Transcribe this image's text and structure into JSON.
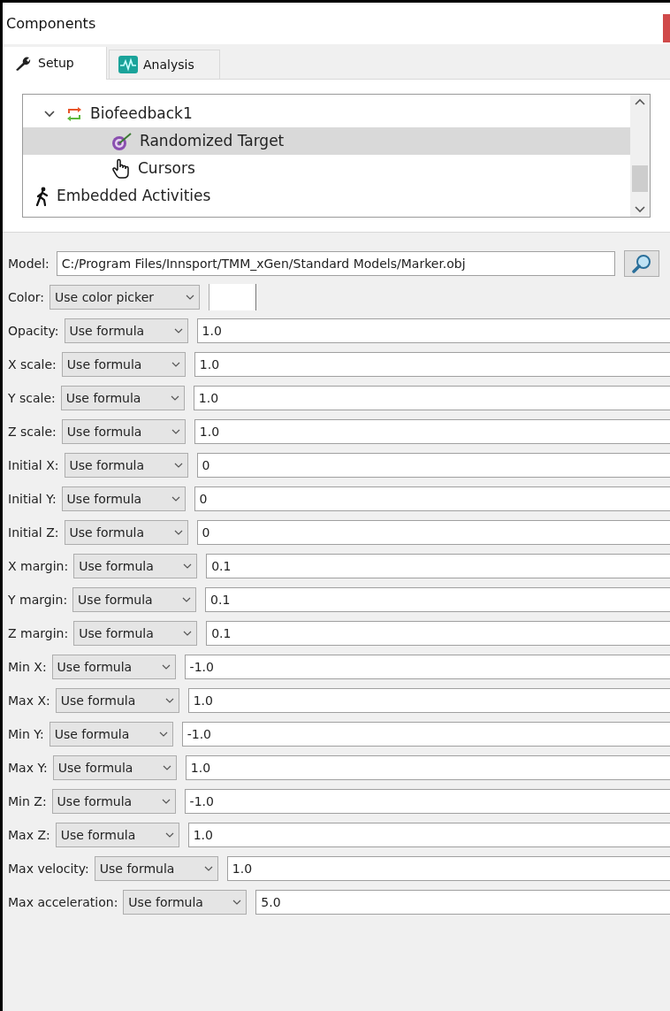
{
  "window": {
    "title": "Components"
  },
  "tabs": [
    {
      "label": "Setup",
      "kind": "wrench",
      "selected": true
    },
    {
      "label": "Analysis",
      "kind": "wave",
      "selected": false
    }
  ],
  "tree": {
    "items": [
      {
        "label": "Biofeedback1",
        "kind": "group",
        "expanded": true,
        "selected": false,
        "children": [
          {
            "label": "Randomized Target",
            "kind": "target",
            "selected": true
          },
          {
            "label": "Cursors",
            "kind": "hand",
            "selected": false
          }
        ]
      },
      {
        "label": "Embedded Activities",
        "kind": "walker",
        "selected": false
      }
    ]
  },
  "properties": [
    {
      "kind": "path",
      "label": "Model:",
      "value": "C:/Program Files/Innsport/TMM_xGen/Standard Models/Marker.obj"
    },
    {
      "kind": "color",
      "label": "Color:",
      "mode": "Use color picker"
    },
    {
      "kind": "formula",
      "label": "Opacity:",
      "mode": "Use formula",
      "value": "1.0"
    },
    {
      "kind": "formula",
      "label": "X scale:",
      "mode": "Use formula",
      "value": "1.0"
    },
    {
      "kind": "formula",
      "label": "Y scale:",
      "mode": "Use formula",
      "value": "1.0"
    },
    {
      "kind": "formula",
      "label": "Z scale:",
      "mode": "Use formula",
      "value": "1.0"
    },
    {
      "kind": "formula",
      "label": "Initial X:",
      "mode": "Use formula",
      "value": "0"
    },
    {
      "kind": "formula",
      "label": "Initial Y:",
      "mode": "Use formula",
      "value": "0"
    },
    {
      "kind": "formula",
      "label": "Initial Z:",
      "mode": "Use formula",
      "value": "0"
    },
    {
      "kind": "formula",
      "label": "X margin:",
      "mode": "Use formula",
      "value": "0.1"
    },
    {
      "kind": "formula",
      "label": "Y margin:",
      "mode": "Use formula",
      "value": "0.1"
    },
    {
      "kind": "formula",
      "label": "Z margin:",
      "mode": "Use formula",
      "value": "0.1"
    },
    {
      "kind": "formula",
      "label": "Min X:",
      "mode": "Use formula",
      "value": "-1.0"
    },
    {
      "kind": "formula",
      "label": "Max X:",
      "mode": "Use formula",
      "value": "1.0"
    },
    {
      "kind": "formula",
      "label": "Min Y:",
      "mode": "Use formula",
      "value": "-1.0"
    },
    {
      "kind": "formula",
      "label": "Max Y:",
      "mode": "Use formula",
      "value": "1.0"
    },
    {
      "kind": "formula",
      "label": "Min Z:",
      "mode": "Use formula",
      "value": "-1.0"
    },
    {
      "kind": "formula",
      "label": "Max Z:",
      "mode": "Use formula",
      "value": "1.0"
    },
    {
      "kind": "formula",
      "label": "Max velocity:",
      "mode": "Use formula",
      "value": "1.0"
    },
    {
      "kind": "formula",
      "label": "Max acceleration:",
      "mode": "Use formula",
      "value": "5.0"
    }
  ]
}
